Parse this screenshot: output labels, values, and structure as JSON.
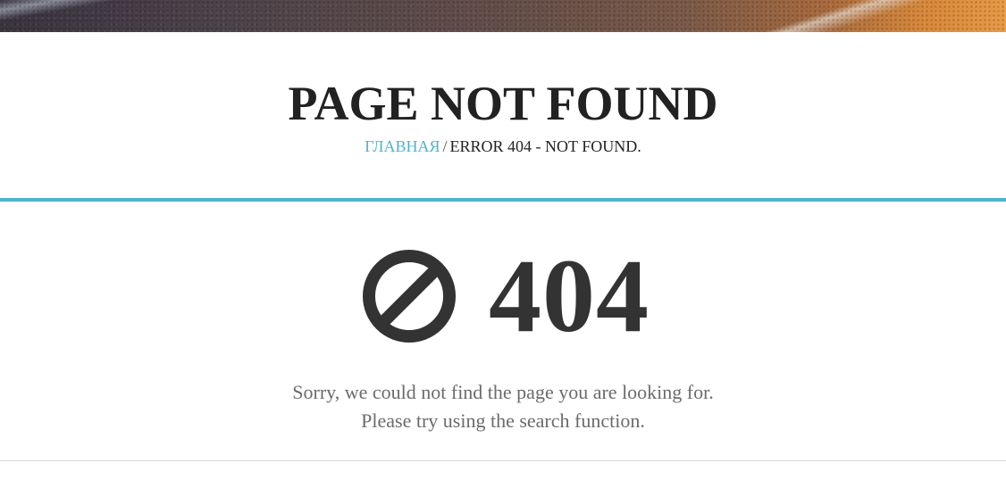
{
  "header": {
    "title": "PAGE NOT FOUND",
    "breadcrumb": {
      "home_label": "ГЛАВНАЯ",
      "separator": "/",
      "current_label": "ERROR 404 - NOT FOUND."
    }
  },
  "error": {
    "icon": "ban-icon",
    "code": "404",
    "message_line1": "Sorry, we could not find the page you are looking for.",
    "message_line2": "Please try using the search function."
  },
  "colors": {
    "accent": "#4fb3cc",
    "title": "#222222",
    "code": "#333333",
    "message": "#6b6b6b"
  }
}
